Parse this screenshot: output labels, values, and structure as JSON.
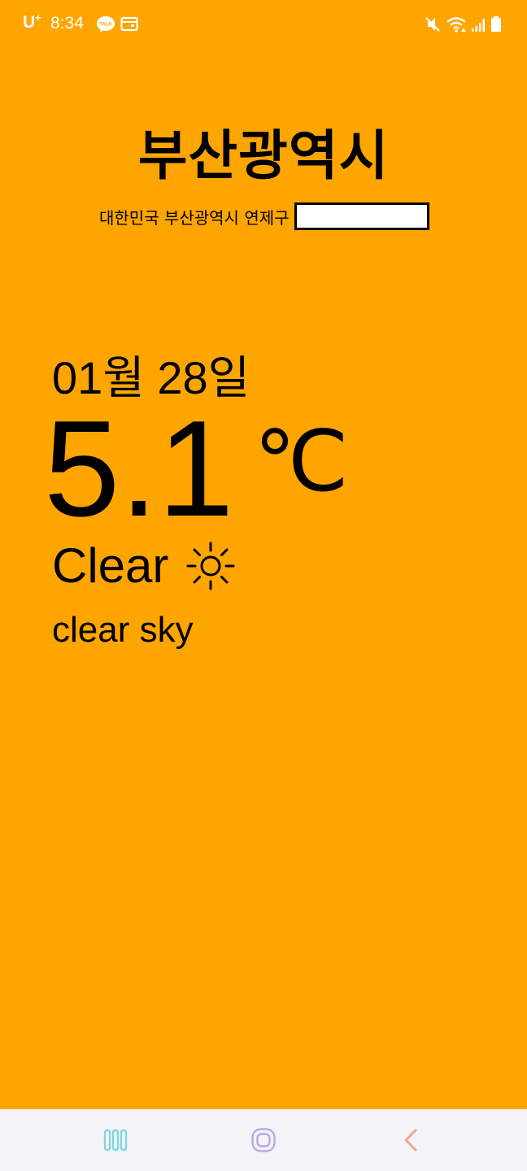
{
  "status_bar": {
    "carrier": "U",
    "carrier_plus": "+",
    "time": "8:34",
    "icons": [
      "talk-icon",
      "wallet-icon",
      "mute-icon",
      "wifi-icon",
      "signal-icon",
      "battery-icon"
    ],
    "talk_label": "TALK"
  },
  "header": {
    "city": "부산광역시",
    "address": "대한민국 부산광역시 연제구"
  },
  "weather": {
    "date": "01월 28일",
    "temperature": "5.1",
    "unit": "℃",
    "condition": "Clear",
    "condition_icon": "sun-icon",
    "description": "clear sky"
  },
  "nav_bar": {
    "buttons": [
      "recent-apps-button",
      "home-button",
      "back-button"
    ]
  },
  "colors": {
    "background": "#FFA500",
    "nav_background": "#F4F4F8",
    "recent_icon": "#7FD6DE",
    "home_icon": "#B9A8E6",
    "back_icon": "#F2A39B"
  }
}
